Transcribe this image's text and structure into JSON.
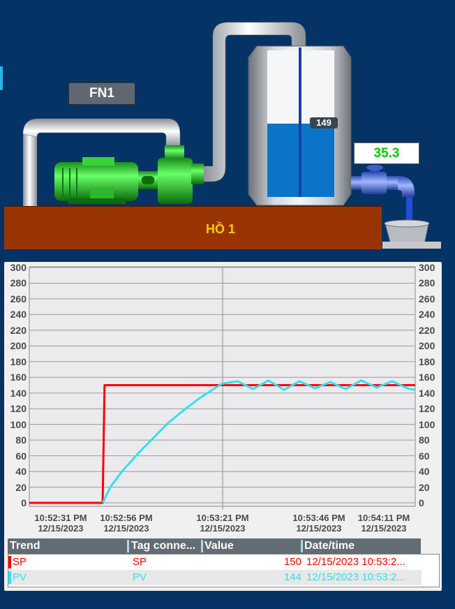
{
  "scada": {
    "fan_label": "FN1",
    "pool_label": "HỒ 1",
    "flow_value": "35.3",
    "tank_level": "149",
    "tank_level_fraction": 0.5
  },
  "trend": {
    "y_ticks": [
      "300",
      "280",
      "260",
      "240",
      "220",
      "200",
      "180",
      "160",
      "140",
      "120",
      "100",
      "80",
      "60",
      "40",
      "20",
      "0"
    ],
    "x_ticks": [
      {
        "time": "10:52:31 PM",
        "date": "12/15/2023"
      },
      {
        "time": "10:52:56 PM",
        "date": "12/15/2023"
      },
      {
        "time": "10:53:21 PM",
        "date": "12/15/2023"
      },
      {
        "time": "10:53:46 PM",
        "date": "12/15/2023"
      },
      {
        "time": "10:54:11 PM",
        "date": "12/15/2023"
      }
    ],
    "colors": {
      "sp": "#ff0000",
      "pv": "#33e0f0"
    }
  },
  "chart_data": {
    "type": "line",
    "x_unit": "seconds",
    "xlim": [
      0,
      100
    ],
    "ylim": [
      0,
      300
    ],
    "series": [
      {
        "name": "SP",
        "x": [
          0,
          19,
          19.5,
          100
        ],
        "values": [
          0,
          0,
          150,
          150
        ]
      },
      {
        "name": "PV",
        "x": [
          19,
          21,
          24,
          28,
          32,
          36,
          40,
          44,
          48,
          50,
          54,
          58,
          62,
          66,
          70,
          74,
          78,
          82,
          86,
          90,
          94,
          98,
          100
        ],
        "values": [
          0,
          20,
          40,
          62,
          82,
          102,
          118,
          133,
          146,
          152,
          155,
          145,
          156,
          144,
          155,
          146,
          154,
          145,
          156,
          147,
          155,
          146,
          144
        ]
      }
    ]
  },
  "table": {
    "headers": [
      "Trend",
      "Tag conne...",
      "Value",
      "Date/time"
    ],
    "rows": [
      {
        "tag": "SP",
        "conn": "SP",
        "value": "150",
        "datetime": "12/15/2023 10:53:2..."
      },
      {
        "tag": "PV",
        "conn": "PV",
        "value": "144",
        "datetime": "12/15/2023 10:53:2..."
      }
    ]
  }
}
